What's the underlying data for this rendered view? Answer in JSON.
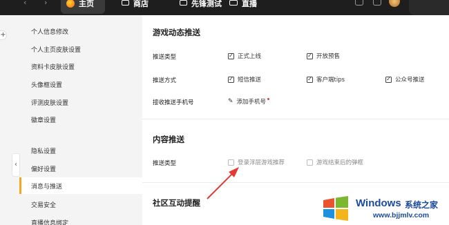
{
  "topbar": {
    "tabs": [
      {
        "label": "主页",
        "icon": "app-logo-icon",
        "active": true
      },
      {
        "label": "商店",
        "icon": "store-icon"
      },
      {
        "label": "先锋测试",
        "icon": "lab-icon"
      },
      {
        "label": "直播",
        "icon": "live-icon"
      }
    ]
  },
  "sidebar": {
    "items": [
      {
        "label": "个人信息修改"
      },
      {
        "label": "个人主页皮肤设置"
      },
      {
        "label": "资料卡皮肤设置"
      },
      {
        "label": "头像框设置"
      },
      {
        "label": "评测皮肤设置"
      },
      {
        "label": "徽章设置"
      },
      {
        "label": "隐私设置"
      },
      {
        "label": "偏好设置"
      },
      {
        "label": "消息与推送",
        "active": true
      },
      {
        "label": "交易安全"
      },
      {
        "label": "直播信息绑定"
      }
    ]
  },
  "main": {
    "game_push": {
      "title": "游戏动态推送",
      "push_type_label": "推送类型",
      "push_type_options": [
        {
          "label": "正式上线",
          "checked": true
        },
        {
          "label": "开放预售",
          "checked": true
        }
      ],
      "push_method_label": "推送方式",
      "push_method_options": [
        {
          "label": "短信推送",
          "checked": true
        },
        {
          "label": "客户端tips",
          "checked": true
        },
        {
          "label": "公众号推送",
          "checked": true
        }
      ],
      "phone_label": "接收推送手机号",
      "add_phone": "添加手机号"
    },
    "content_push": {
      "title": "内容推送",
      "push_type_label": "推送类型",
      "options": [
        {
          "label": "登录浮层游戏推荐",
          "checked": false
        },
        {
          "label": "游戏结束后的弹框",
          "checked": false
        }
      ]
    },
    "community": {
      "title": "社区互动提醒"
    }
  },
  "watermark": {
    "brand": "Windows",
    "suffix": "系统之家",
    "url": "www.bjjmlv.com"
  },
  "colors": {
    "accent": "#f5a623",
    "topbar": "#1e1e1e",
    "annotation": "#e53935"
  }
}
